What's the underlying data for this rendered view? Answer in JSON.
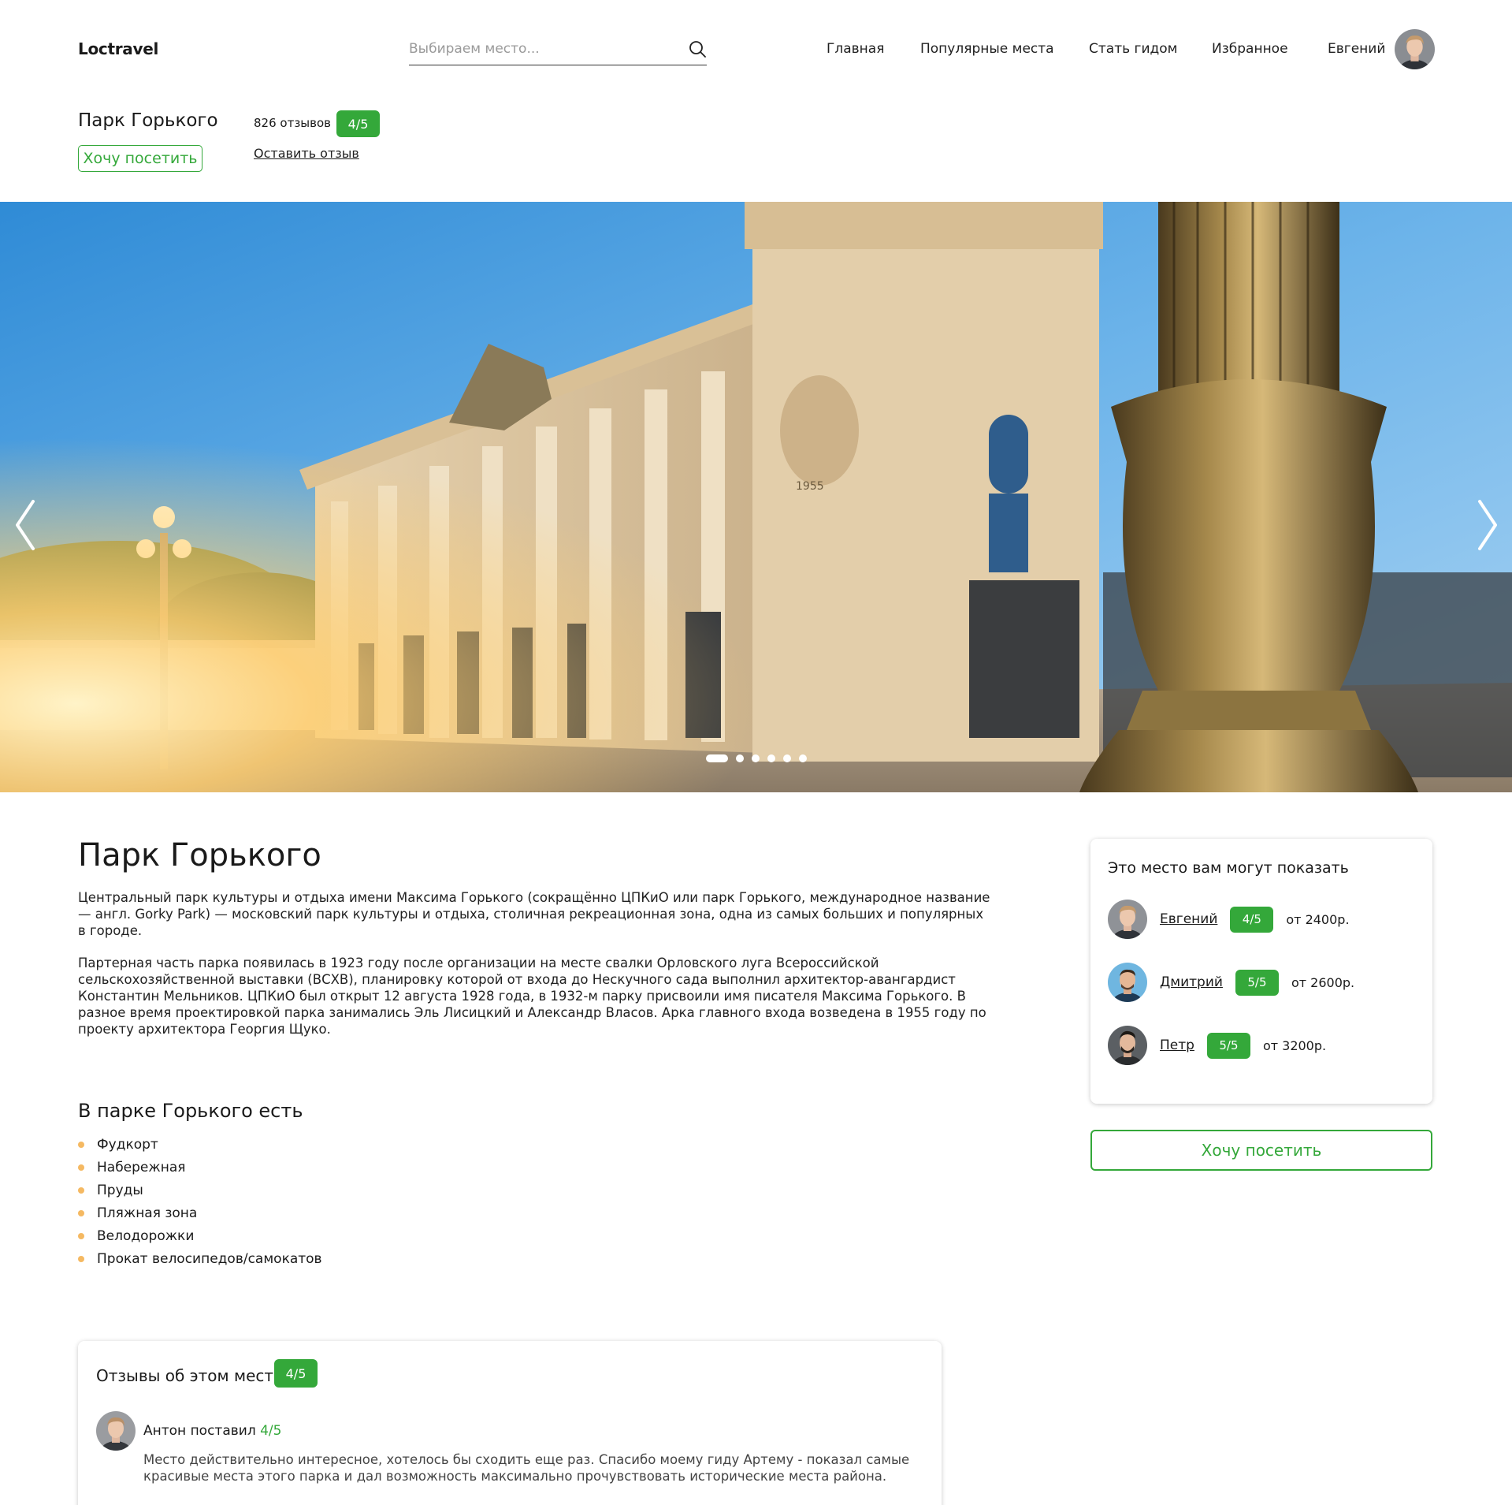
{
  "header": {
    "logo": "Loctravel",
    "search_placeholder": "Выбираем место...",
    "nav": [
      "Главная",
      "Популярные места",
      "Стать гидом",
      "Избранное"
    ],
    "user_name": "Евгений"
  },
  "place": {
    "title": "Парк Горького",
    "reviews_count": "826 отзывов",
    "rating": "4/5",
    "want_visit": "Хочу посетить",
    "leave_review": "Оставить отзыв"
  },
  "gallery": {
    "slide_count": 6,
    "active_slide": 1,
    "sign_text": "1955"
  },
  "content": {
    "heading": "Парк Горького",
    "paragraphs": [
      "Центральный парк культуры и отдыха имени Максима Горького (сокращённо ЦПКиО или парк Горького, международное название — англ. Gorky Park) — московский парк культуры и отдыха, столичная рекреационная зона, одна из самых больших и популярных в городе.",
      "Партерная часть парка появилась в 1923 году после организации на месте свалки Орловского луга Всероссийской сельскохозяйственной выставки (ВСХВ), планировку которой от входа до Нескучного сада выполнил архитектор-авангардист Константин Мельников. ЦПКиО был открыт 12 августа 1928 года, в 1932-м парку присвоили имя писателя Максима Горького. В разное время проектировкой парка занимались Эль Лисицкий и Александр Власов. Арка главного входа возведена в 1955 году по проекту архитектора Георгия Щуко."
    ],
    "features_title": "В парке Горького есть",
    "features": [
      "Фудкорт",
      "Набережная",
      "Пруды",
      "Пляжная зона",
      "Велодорожки",
      "Прокат велосипедов/самокатов"
    ]
  },
  "guides": {
    "title": "Это место вам могут показать",
    "items": [
      {
        "name": "Евгений",
        "rating": "4/5",
        "price": "от 2400р."
      },
      {
        "name": "Дмитрий",
        "rating": "5/5",
        "price": "от 2600р."
      },
      {
        "name": "Петр",
        "rating": "5/5",
        "price": "от 3200р."
      }
    ],
    "want_visit": "Хочу посетить"
  },
  "reviews": {
    "title": "Отзывы об этом месте",
    "rating": "4/5",
    "items": [
      {
        "author_prefix": "Антон поставил ",
        "score": "4/5",
        "text": "Место действительно интересное, хотелось бы сходить еще раз. Спасибо моему гиду Артему - показал самые красивые места этого парка и дал возможность максимально прочувствовать исторические места района."
      }
    ]
  },
  "colors": {
    "accent_green": "#34a83a",
    "bullet_orange": "#f5b962"
  }
}
